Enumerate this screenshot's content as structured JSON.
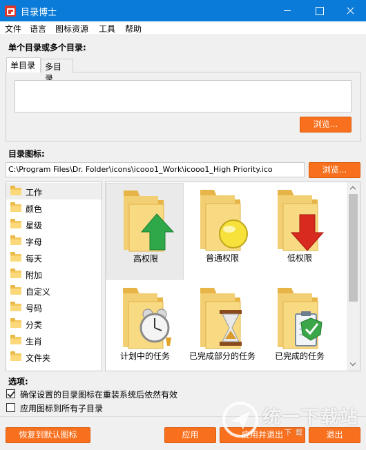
{
  "window": {
    "title": "目录博士"
  },
  "menu": [
    "文件",
    "语言",
    "图标资源",
    "工具",
    "帮助"
  ],
  "folders_section": {
    "label": "单个目录或多个目录:",
    "tabs": [
      "单目录",
      "多目录"
    ],
    "browse_label": "浏览..."
  },
  "icon_section": {
    "label": "目录图标:",
    "path": "C:\\Program Files\\Dr. Folder\\icons\\icooo1_Work\\icooo1_High Priority.ico",
    "browse_label": "浏览..."
  },
  "categories": [
    "工作",
    "颜色",
    "星级",
    "字母",
    "每天",
    "附加",
    "自定义",
    "号码",
    "分类",
    "生肖",
    "文件夹"
  ],
  "icons": [
    {
      "label": "高权限",
      "badge": "green-up-arrow"
    },
    {
      "label": "普通权限",
      "badge": "yellow-circle"
    },
    {
      "label": "低权限",
      "badge": "red-down-arrow"
    },
    {
      "label": "计划中的任务",
      "badge": "alarm-clock"
    },
    {
      "label": "已完成部分的任务",
      "badge": "hourglass"
    },
    {
      "label": "已完成的任务",
      "badge": "clipboard-check"
    }
  ],
  "options": {
    "label": "选项:",
    "items": [
      {
        "label": "确保设置的目录图标在重装系统后依然有效",
        "checked": true
      },
      {
        "label": "应用图标到所有子目录",
        "checked": false
      }
    ]
  },
  "buttons": {
    "restore": "恢复到默认图标",
    "apply": "应用",
    "apply_exit": "应用并退出",
    "exit": "退出"
  },
  "watermark": {
    "text": "统一下载站",
    "sub": "下载"
  },
  "colors": {
    "titlebar": "#0a7bd8",
    "accent_button": "#f8701e",
    "folder": "#f5c95e"
  }
}
